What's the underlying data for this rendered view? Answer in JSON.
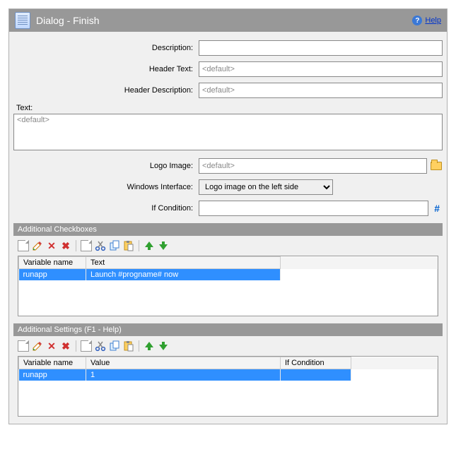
{
  "header": {
    "title": "Dialog  -  Finish",
    "help_label": "Help"
  },
  "form": {
    "description_label": "Description:",
    "description_value": "",
    "header_text_label": "Header Text:",
    "header_text_placeholder": "<default>",
    "header_desc_label": "Header Description:",
    "header_desc_placeholder": "<default>",
    "text_label": "Text:",
    "text_placeholder": "<default>",
    "logo_label": "Logo Image:",
    "logo_placeholder": "<default>",
    "win_interface_label": "Windows Interface:",
    "win_interface_value": "Logo image on the left side",
    "if_condition_label": "If Condition:",
    "if_condition_value": ""
  },
  "checkboxes": {
    "title": "Additional Checkboxes",
    "col_var": "Variable name",
    "col_text": "Text",
    "rows": {
      "0": {
        "var": "runapp",
        "text": "Launch #progname# now"
      }
    }
  },
  "settings": {
    "title": "Additional Settings (F1 - Help)",
    "col_var": "Variable name",
    "col_val": "Value",
    "col_cond": "If Condition",
    "rows": {
      "0": {
        "var": "runapp",
        "val": "1",
        "cond": ""
      }
    }
  }
}
